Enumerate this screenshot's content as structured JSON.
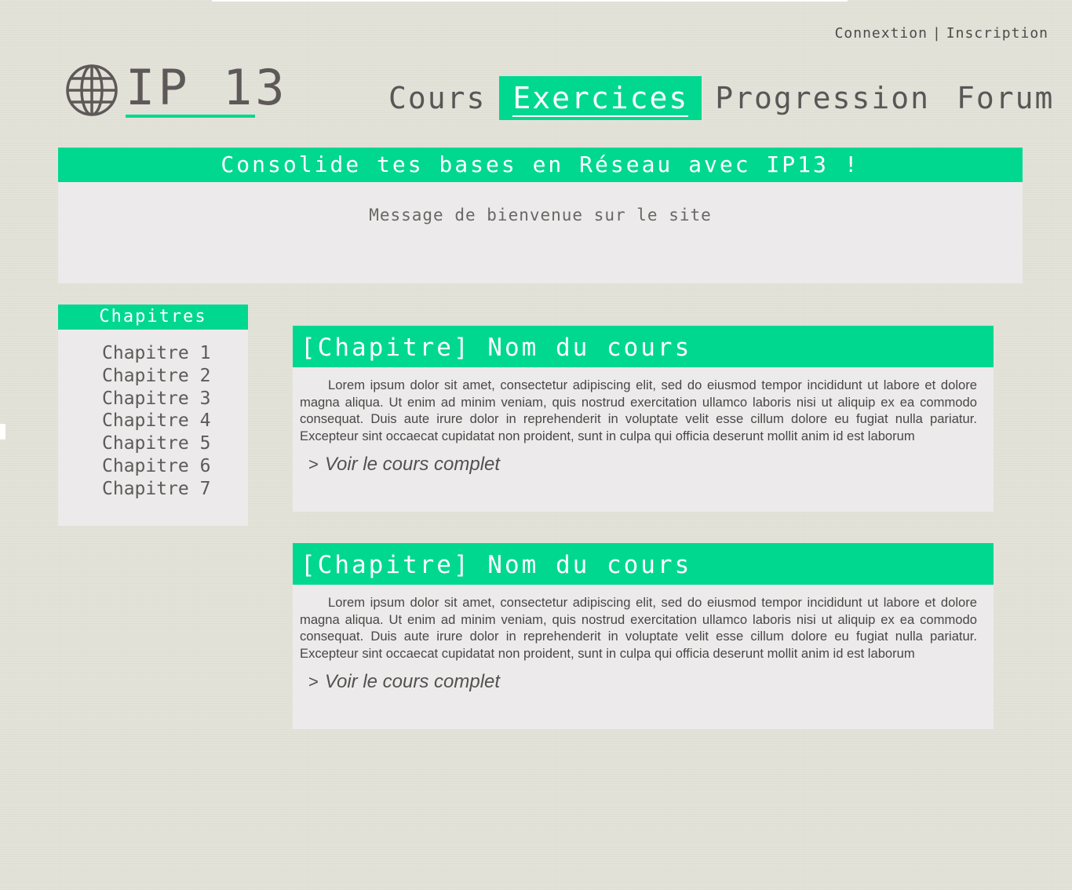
{
  "auth": {
    "login": "Connextion",
    "separator": "|",
    "signup": "Inscription"
  },
  "logo": {
    "text": "IP 13",
    "icon": "globe-icon"
  },
  "nav": [
    {
      "label": "Cours",
      "active": false
    },
    {
      "label": "Exercices",
      "active": true
    },
    {
      "label": "Progression",
      "active": false
    },
    {
      "label": "Forum",
      "active": false
    }
  ],
  "banner": {
    "title": "Consolide tes bases en Réseau avec IP13 !",
    "welcome": "Message de bienvenue sur le site"
  },
  "sidebar": {
    "title": "Chapitres",
    "items": [
      "Chapitre 1",
      "Chapitre 2",
      "Chapitre 3",
      "Chapitre 4",
      "Chapitre 5",
      "Chapitre 6",
      "Chapitre 7"
    ]
  },
  "courses": [
    {
      "title": "[Chapitre] Nom du cours",
      "text": "Lorem ipsum dolor sit amet, consectetur adipiscing elit, sed do eiusmod tempor incididunt ut labore et dolore magna aliqua. Ut enim ad minim veniam, quis nostrud exercitation ullamco laboris nisi ut aliquip ex ea commodo consequat. Duis aute irure dolor in reprehenderit in voluptate velit esse cillum dolore eu fugiat nulla pariatur. Excepteur sint occaecat cupidatat non proident, sunt in culpa qui officia deserunt mollit anim id est laborum",
      "link_arrow": ">",
      "link": "Voir le cours complet"
    },
    {
      "title": "[Chapitre] Nom du cours",
      "text": "Lorem ipsum dolor sit amet, consectetur adipiscing elit, sed do eiusmod tempor incididunt ut labore et dolore magna aliqua. Ut enim ad minim veniam, quis nostrud exercitation ullamco laboris nisi ut aliquip ex ea commodo consequat. Duis aute irure dolor in reprehenderit in voluptate velit esse cillum dolore eu fugiat nulla pariatur. Excepteur sint occaecat cupidatat non proident, sunt in culpa qui officia deserunt mollit anim id est laborum",
      "link_arrow": ">",
      "link": "Voir le cours complet"
    }
  ],
  "colors": {
    "accent": "#00d890",
    "panel": "#eceaea",
    "background": "#e3e2d8",
    "text": "#5a5656"
  }
}
